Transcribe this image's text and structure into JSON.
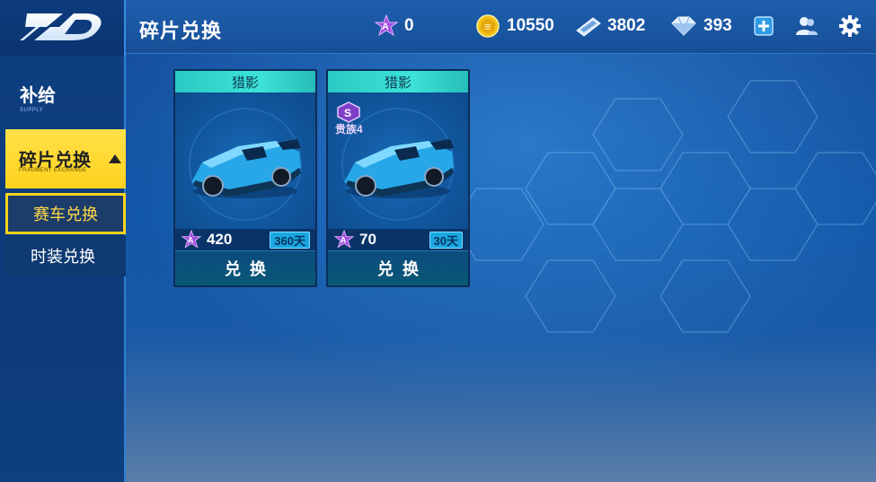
{
  "header": {
    "title": "碎片兑换",
    "stats": [
      {
        "name": "fragment",
        "value": "0",
        "icon": "purple-star-fragment-icon"
      },
      {
        "name": "coins",
        "value": "10550",
        "icon": "gold-coin-icon"
      },
      {
        "name": "tickets",
        "value": "3802",
        "icon": "ticket-icon"
      },
      {
        "name": "diamonds",
        "value": "393",
        "icon": "diamond-icon"
      }
    ]
  },
  "sidebar": {
    "supply": {
      "label": "补给",
      "sublabel": "SUPPLY"
    },
    "active": {
      "label": "碎片兑换",
      "sublabel": "FRAGMENT EXCHANGE"
    },
    "items": [
      {
        "label": "赛车兑换",
        "selected": true
      },
      {
        "label": "时装兑换",
        "selected": false
      }
    ]
  },
  "cards": [
    {
      "name": "猎影",
      "price": "420",
      "duration": "360天",
      "button": "兑换",
      "badge": ""
    },
    {
      "name": "猎影",
      "price": "70",
      "duration": "30天",
      "button": "兑换",
      "badge": "贵族4"
    }
  ],
  "colors": {
    "accent_yellow": "#ffd21c",
    "card_header": "#3de3d6",
    "background_blue": "#174f9c"
  }
}
